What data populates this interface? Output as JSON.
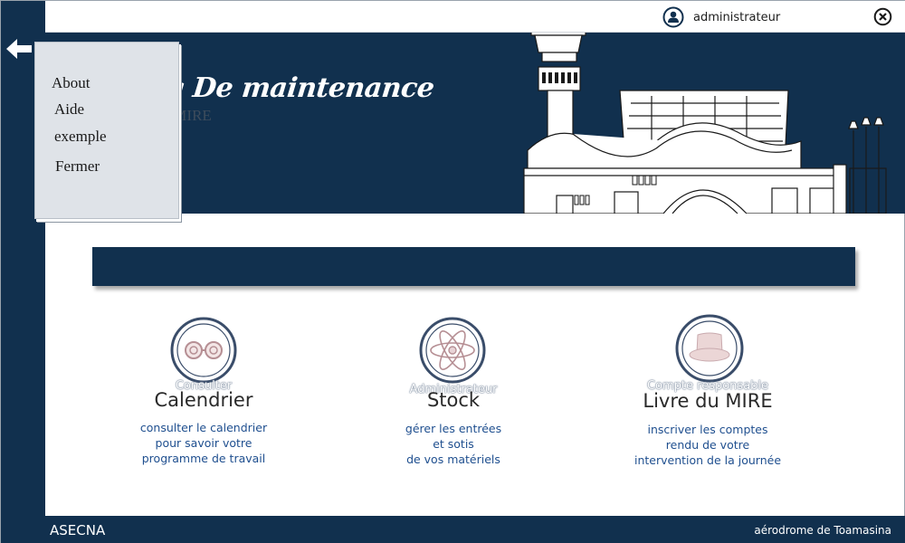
{
  "header": {
    "user_name": "administrateur",
    "user_icon": "user-circle-icon",
    "close_icon": "close-circle-icon"
  },
  "banner": {
    "title": "Planning De maintenance",
    "subtitle": "Département du MIRE"
  },
  "menu": {
    "items": [
      {
        "label": "About"
      },
      {
        "label": "Aide"
      },
      {
        "label": "exemple"
      },
      {
        "label": "Fermer"
      }
    ]
  },
  "cards": [
    {
      "caption": "Consulter",
      "title": "Calendrier",
      "desc": [
        "consulter le calendrier",
        "pour savoir votre",
        "programme de travail"
      ],
      "icon": "glasses-icon"
    },
    {
      "caption": "Administrateur",
      "title": "Stock",
      "desc": [
        "gérer les entrées",
        "et sotis",
        "de vos matériels"
      ],
      "icon": "atom-icon"
    },
    {
      "caption": "Compte responsable",
      "title": "Livre du MIRE",
      "desc": [
        "inscriver les comptes",
        "rendu de votre",
        "intervention de la journée"
      ],
      "icon": "hat-icon"
    }
  ],
  "footer": {
    "left": "ASECNA",
    "right": "aérodrome de Toamasina"
  },
  "colors": {
    "navy": "#11304e",
    "link_blue": "#1f4f8f",
    "menu_bg": "#dfe3e8"
  }
}
